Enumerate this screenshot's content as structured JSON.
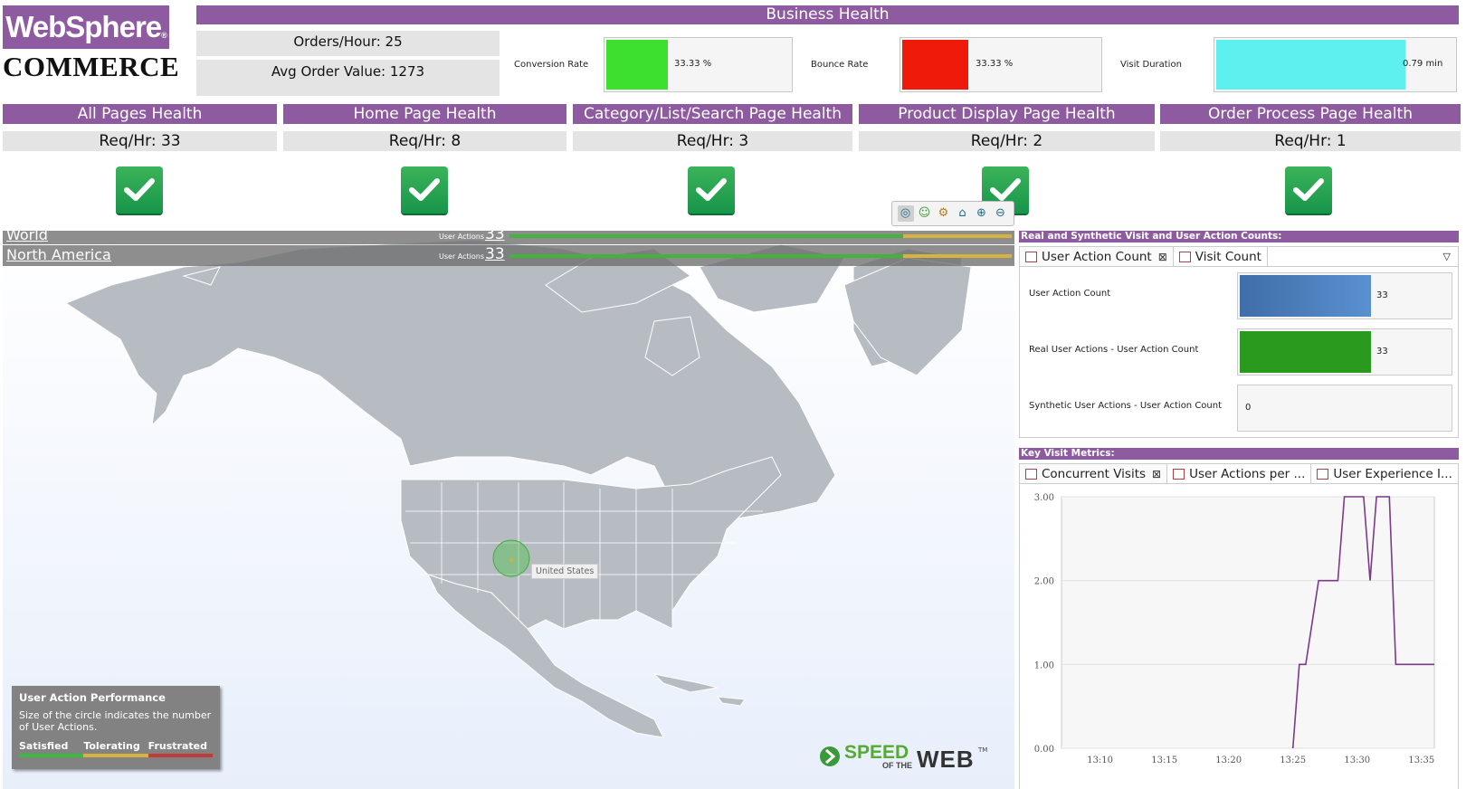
{
  "logo": {
    "top": "WebSphere",
    "bottom": "COMMERCE"
  },
  "business_health": {
    "title": "Business Health",
    "orders_per_hour": "Orders/Hour: 25",
    "avg_order_value": "Avg Order Value: 1273",
    "kpis": [
      {
        "label": "Conversion Rate",
        "value": "33.33 %",
        "fill_fraction": 0.33,
        "color": "#3ee030"
      },
      {
        "label": "Bounce Rate",
        "value": "33.33 %",
        "fill_fraction": 0.33,
        "color": "#f01a0a"
      },
      {
        "label": "Visit Duration",
        "value": "0.79 min",
        "fill_fraction": 0.79,
        "color": "#5eefef"
      }
    ]
  },
  "page_health": [
    {
      "title": "All Pages Health",
      "req": "Req/Hr: 33"
    },
    {
      "title": "Home Page Health",
      "req": "Req/Hr: 8"
    },
    {
      "title": "Category/List/Search Page Health",
      "req": "Req/Hr: 3"
    },
    {
      "title": "Product Display Page Health",
      "req": "Req/Hr: 2"
    },
    {
      "title": "Order Process Page Health",
      "req": "Req/Hr: 1"
    }
  ],
  "map": {
    "regions": [
      {
        "name": "World",
        "ua_label": "User Actions",
        "ua_value": "33"
      },
      {
        "name": "North America",
        "ua_label": "User Actions",
        "ua_value": "33"
      }
    ],
    "location_label": "United States",
    "legend": {
      "title": "User Action Performance",
      "description": "Size of the circle indicates the number of User Actions.",
      "items": [
        {
          "label": "Satisfied",
          "color": "#3cb83c"
        },
        {
          "label": "Tolerating",
          "color": "#d6b33c"
        },
        {
          "label": "Frustrated",
          "color": "#c23b3b"
        }
      ]
    },
    "brand": {
      "line1": "SPEED",
      "line2": "OF THE",
      "line3": "WEB",
      "tm": "TM"
    }
  },
  "visit_counts": {
    "header": "Real and Synthetic Visit and User Action Counts:",
    "tabs": [
      {
        "label": "User Action Count"
      },
      {
        "label": "Visit Count"
      }
    ],
    "rows": [
      {
        "label": "User Action Count",
        "value": "33",
        "fill_fraction": 0.62,
        "color": "#4f7fbf"
      },
      {
        "label": "Real User Actions - User Action Count",
        "value": "33",
        "fill_fraction": 0.62,
        "color": "#2a9a1e"
      },
      {
        "label": "Synthetic User Actions - User Action Count",
        "value": "0",
        "fill_fraction": 0,
        "color": "#2a9a1e"
      }
    ]
  },
  "key_visit_metrics": {
    "header": "Key Visit Metrics:",
    "tabs": [
      {
        "label": "Concurrent Visits"
      },
      {
        "label": "User Actions per ..."
      },
      {
        "label": "User Experience I..."
      }
    ]
  },
  "chart_data": {
    "type": "line",
    "title": "",
    "xlabel": "",
    "ylabel": "",
    "x_ticks": [
      "13:10",
      "13:15",
      "13:20",
      "13:25",
      "13:30",
      "13:35"
    ],
    "y_ticks": [
      "0.00",
      "1.00",
      "2.00",
      "3.00"
    ],
    "ylim": [
      0,
      3
    ],
    "xlim": [
      "13:07",
      "13:36"
    ],
    "x": [
      "13:25",
      "13:25.5",
      "13:26",
      "13:27",
      "13:28.5",
      "13:29",
      "13:30.5",
      "13:31",
      "13:31.5",
      "13:32.5",
      "13:33",
      "13:36"
    ],
    "values": [
      0,
      1,
      1,
      2,
      2,
      3,
      3,
      2,
      3,
      3,
      1,
      1
    ],
    "color": "#7b3a8a",
    "grid": "horizontal"
  }
}
